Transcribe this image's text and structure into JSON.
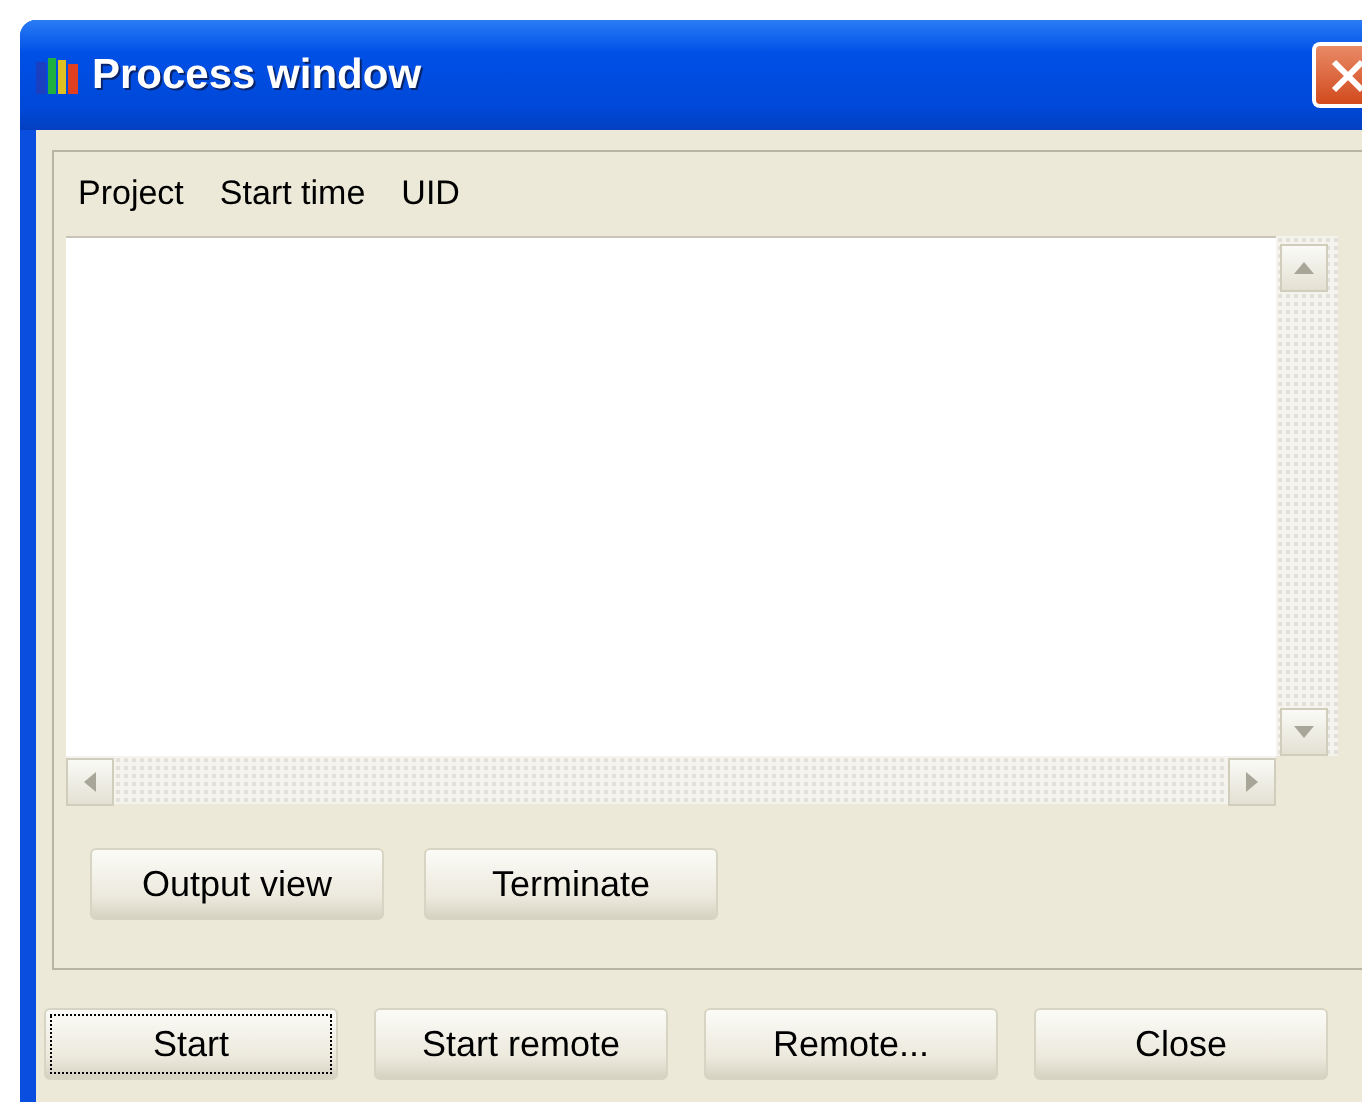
{
  "window": {
    "title": "Process window"
  },
  "list": {
    "columns": [
      "Project",
      "Start time",
      "UID"
    ]
  },
  "panel_buttons": [
    {
      "label": "Output view",
      "focused": false
    },
    {
      "label": "Terminate",
      "focused": false
    }
  ],
  "dialog_buttons": [
    {
      "label": "Start",
      "focused": true
    },
    {
      "label": "Start remote",
      "focused": false
    },
    {
      "label": "Remote...",
      "focused": false
    },
    {
      "label": "Close",
      "focused": false
    }
  ]
}
